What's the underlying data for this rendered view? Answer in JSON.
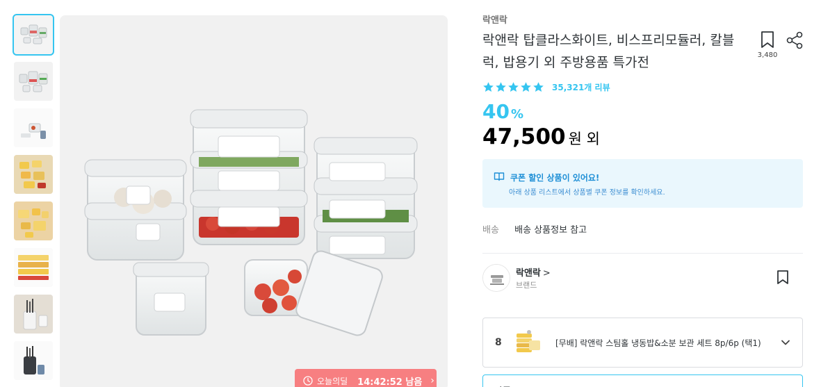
{
  "thumbnails": [
    {
      "alt": "container-set-thumb",
      "active": true
    },
    {
      "alt": "container-set-thumb-2",
      "active": false
    },
    {
      "alt": "lock-lock-thumb",
      "active": false
    },
    {
      "alt": "food-containers-thumb",
      "active": false
    },
    {
      "alt": "food-containers-thumb-2",
      "active": false
    },
    {
      "alt": "stacked-containers-thumb",
      "active": false
    },
    {
      "alt": "knife-block-thumb",
      "active": false
    },
    {
      "alt": "knife-set-thumb",
      "active": false
    }
  ],
  "deal": {
    "label": "오늘의딜",
    "time": "14:42:52 남음"
  },
  "product": {
    "brand": "락앤락",
    "title": "락앤락 탑클라스화이트, 비스프리모듈러, 칼블럭, 밥용기 외 주방용품 특가전",
    "scrap_count": "3,480",
    "rating_stars": 5,
    "review_count": "35,321개 리뷰",
    "discount_value": "40",
    "discount_unit": "%",
    "price_value": "47,500",
    "price_suffix": "원 외"
  },
  "coupon": {
    "title": "쿠폰 할인 상품이 있어요!",
    "description": "아래 상품 리스트에서 상품별 쿠폰 정보를 확인하세요."
  },
  "shipping": {
    "label": "배송",
    "value": "배송 상품정보 참고"
  },
  "brand_card": {
    "name": "락앤락",
    "chevron": ">",
    "subtitle": "브랜드"
  },
  "option": {
    "number": "8",
    "text": "[무배] 락앤락 스팀홀 냉동밥&소분 보관 세트 8p/6p (택1)"
  },
  "select": {
    "placeholder": "단품"
  },
  "colors": {
    "accent": "#35c5f0",
    "deal": "#f77f81",
    "coupon_bg": "#eaf7fd"
  }
}
